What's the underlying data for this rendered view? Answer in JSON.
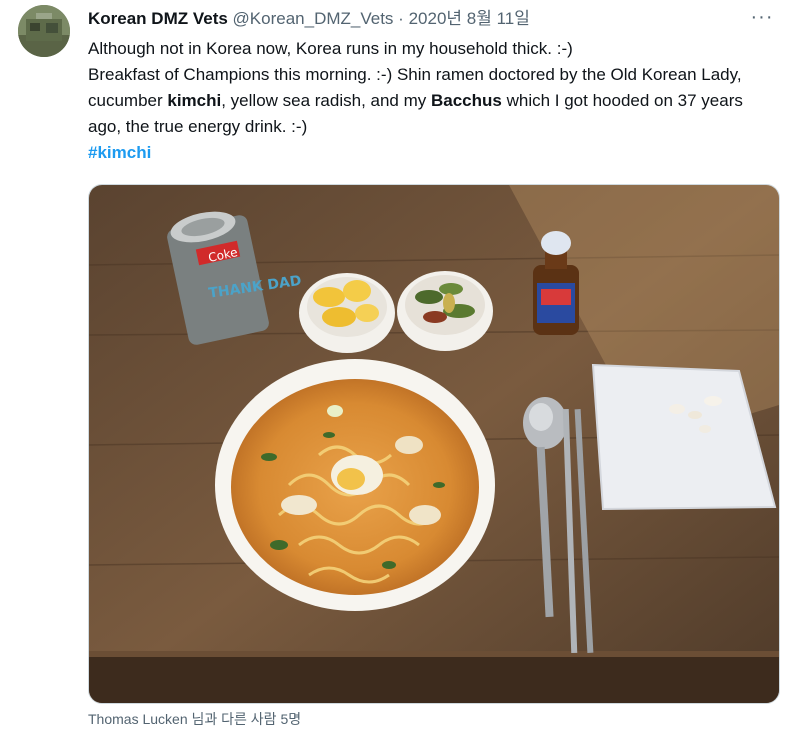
{
  "author": {
    "display_name": "Korean DMZ Vets",
    "handle": "@Korean_DMZ_Vets",
    "separator": "·",
    "date": "2020년 8월 11일"
  },
  "menu": {
    "more_label": "···"
  },
  "tweet": {
    "line1": "Although not in Korea now, Korea runs in my household thick.  :-)",
    "line2_a": "Breakfast of Champions this morning.  :-)  Shin ramen doctored by the Old Korean Lady, cucumber ",
    "kimchi_bold": "kimchi",
    "line2_b": ", yellow sea radish, and my ",
    "bacchus_bold": "Bacchus",
    "line2_c": " which I got hooded on 37 years ago, the true energy drink.  :-)",
    "hashtag": "#kimchi"
  },
  "media": {
    "can_label_brand": "Coke",
    "can_label_text": "THANK DAD"
  },
  "footer": {
    "tagged_text": "Thomas Lucken 님과 다른 사람 5명"
  }
}
